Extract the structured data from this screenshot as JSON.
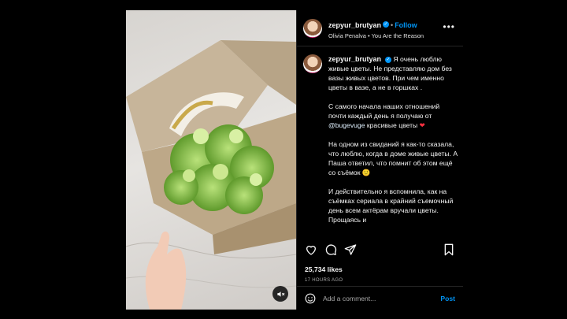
{
  "post": {
    "username": "zepyur_brutyan",
    "follow_label": "Follow",
    "audio": "Olivia Penalva • You Are the Reason",
    "caption_paragraphs": [
      "Я очень люблю живые цветы. Не представляю дом без вазы живых цветов. При чем именно цветы в вазе, а не в горшках .",
      "С самого начала наших отношений почти каждый день я получаю от",
      "@bugevuge",
      "красивые цветы",
      "На одном из свиданий я как-то сказала, что люблю, когда в доме живые цветы. А Паша ответил, что помнит об этом ещё со съёмок 🙂",
      "И действительно я вспомнила, как на съёмках сериала в крайний съемочный день всем актёрам вручали цветы. Прощаясь и"
    ],
    "likes": "25,734 likes",
    "time": "17 HOURS AGO",
    "comment_placeholder": "Add a comment...",
    "post_label": "Post"
  },
  "icons": {
    "verified": "verified-badge-icon",
    "more": "more-options-icon",
    "like": "heart-icon",
    "comment": "comment-icon",
    "share": "share-icon",
    "save": "bookmark-icon",
    "emoji": "emoji-icon",
    "mute": "mute-icon",
    "heart_emoji": "red-heart-icon"
  },
  "colors": {
    "accent": "#0095f6",
    "background": "#000000",
    "heart": "#ff3040"
  }
}
